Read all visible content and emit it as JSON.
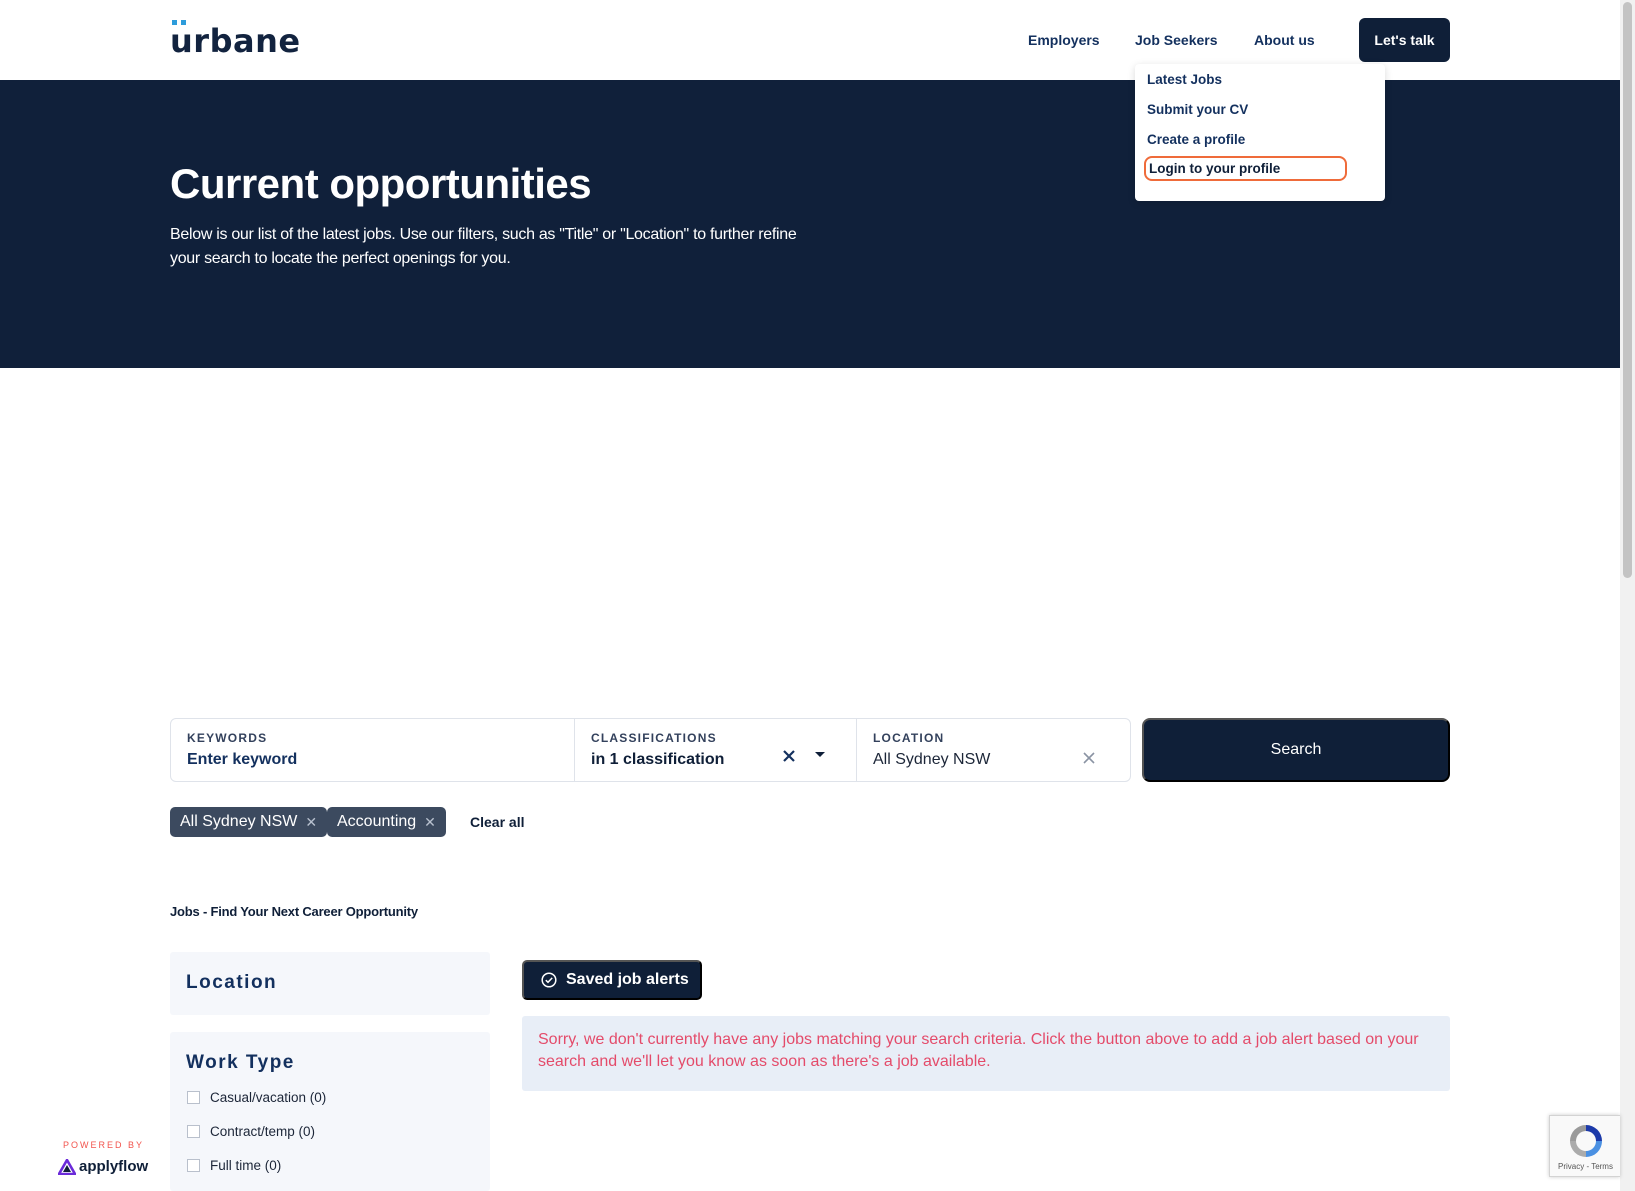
{
  "brand": {
    "logo_text": "urbane",
    "accent": "#2d9cdb",
    "navy": "#0f1f38"
  },
  "nav": {
    "employers": "Employers",
    "job_seekers": "Job Seekers",
    "about": "About us",
    "cta": "Let's talk"
  },
  "dropdown": {
    "items": [
      "Latest Jobs",
      "Submit your CV",
      "Create a profile",
      "Login to your profile"
    ],
    "highlight_color": "#ef6b3a"
  },
  "hero": {
    "title": "Current opportunities",
    "description": "Below is our list of the latest jobs. Use our filters, such as \"Title\" or \"Location\" to further refine your search to locate the perfect openings for you."
  },
  "search": {
    "keywords_label": "KEYWORDS",
    "keywords_placeholder": "Enter keyword",
    "classifications_label": "CLASSIFICATIONS",
    "classifications_value": "in 1 classification",
    "location_label": "LOCATION",
    "location_value": "All Sydney NSW",
    "button": "Search"
  },
  "chips": {
    "items": [
      "All Sydney NSW",
      "Accounting"
    ],
    "clear_all": "Clear all"
  },
  "section_title": "Jobs - Find Your Next Career Opportunity",
  "filters": {
    "location_title": "Location",
    "work_type_title": "Work Type",
    "work_types": [
      "Casual/vacation (0)",
      "Contract/temp (0)",
      "Full time (0)"
    ]
  },
  "results": {
    "saved_alerts": "Saved job alerts",
    "notice": "Sorry, we don't currently have any jobs matching your search criteria. Click the button above to add a job alert based on your search and we'll let you know as soon as there's a job available.",
    "notice_color": "#e44b6a"
  },
  "footer": {
    "powered_by": "POWERED BY",
    "powered_brand": "applyflow",
    "recaptcha": "Privacy - Terms"
  }
}
